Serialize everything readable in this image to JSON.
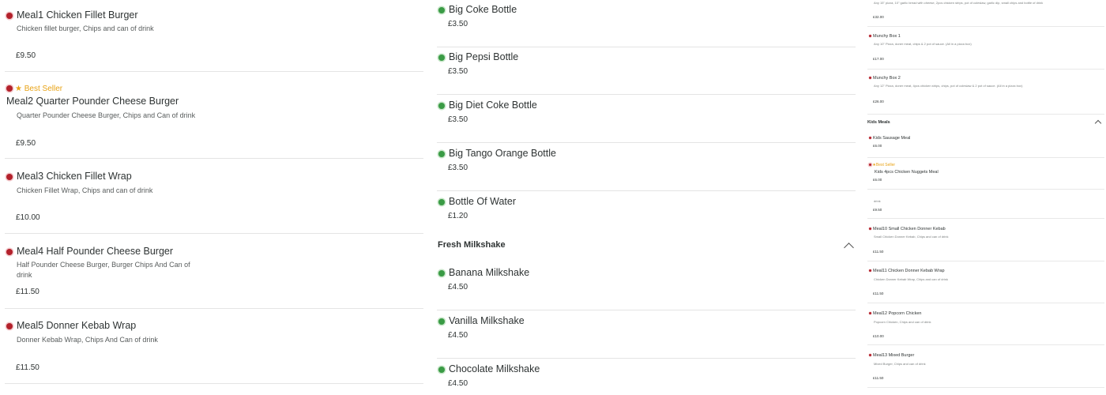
{
  "colors": {
    "nonveg": "#b3212b",
    "veg": "#3a9b45",
    "best_seller": "#e8a317"
  },
  "left": {
    "items": [
      {
        "name": "Meal1 Chicken Fillet Burger",
        "desc": "Chicken fillet burger, Chips and can of drink",
        "price": "£9.50"
      },
      {
        "badge": "Best Seller",
        "name": "Meal2 Quarter Pounder Cheese Burger",
        "desc": "Quarter Pounder Cheese Burger, Chips and Can of drink",
        "price": "£9.50"
      },
      {
        "name": "Meal3 Chicken Fillet Wrap",
        "desc": "Chicken Fillet Wrap, Chips and can of drink",
        "price": "£10.00"
      },
      {
        "name": "Meal4 Half Pounder Cheese Burger",
        "desc": "Half Pounder Cheese Burger, Burger Chips And Can of drink",
        "price": "£11.50"
      },
      {
        "name": "Meal5 Donner Kebab Wrap",
        "desc": "Donner Kebab Wrap, Chips And Can of drink",
        "price": "£11.50"
      }
    ]
  },
  "middle": {
    "items": [
      {
        "name": "Big Coke Bottle",
        "price": "£3.50"
      },
      {
        "name": "Big Pepsi Bottle",
        "price": "£3.50"
      },
      {
        "name": "Big Diet Coke Bottle",
        "price": "£3.50"
      },
      {
        "name": "Big Tango Orange Bottle",
        "price": "£3.50"
      },
      {
        "name": "Bottle Of Water",
        "price": "£1.20"
      }
    ],
    "section_title": "Fresh Milkshake",
    "milkshakes": [
      {
        "name": "Banana Milkshake",
        "price": "£4.50"
      },
      {
        "name": "Vanilla Milkshake",
        "price": "£4.50"
      },
      {
        "name": "Chocolate Milkshake",
        "price": "£4.50"
      }
    ]
  },
  "right": {
    "top_desc": "Any 15\" pizza, 10\" garlic bread with cheese, 2pcs chicken strips, pot of coleslaw, garlic dip, small chips and bottle of drink",
    "top_price": "£32.00",
    "boxes": [
      {
        "name": "Munchy Box 1",
        "desc": "Any 10\" Pizza, doner meat, chips & 2 pot of sauce. (All in a pizza box)",
        "price": "£17.00"
      },
      {
        "name": "Munchy Box 2",
        "desc": "Any 12\" Pizza, doner meat, 4pcs chicken strips, chips, pot of coleslaw & 2 pot of sauce. (All in a pizza box)",
        "price": "£26.00"
      }
    ],
    "section_title": "Kids Meals",
    "kids": [
      {
        "name": "Kids Sausage Meal",
        "price": "£6.00"
      },
      {
        "badge": "Best Seller",
        "name": "Kids 4pcs Chicken Nuggets Meal",
        "price": "£6.00"
      }
    ],
    "partial": {
      "desc": "drink",
      "price": "£9.50"
    },
    "meals": [
      {
        "name": "Meal10 Small Chicken Donner Kebab",
        "desc": "Small Chicken Donner Kebab, Chips and can of drink",
        "price": "£11.50"
      },
      {
        "name": "Meal11 Chicken Donner Kebab Wrap",
        "desc": "Chicken Donner Kebab Wrap, Chips and can of drink",
        "price": "£11.50"
      },
      {
        "name": "Meal12 Popcorn Chicken",
        "desc": "Popcorn Chicken, Chips and can of drink",
        "price": "£10.00"
      },
      {
        "name": "Meal13 Mixed Burger",
        "desc": "Mixed Burger, Chips and can of drink",
        "price": "£11.50"
      }
    ]
  }
}
